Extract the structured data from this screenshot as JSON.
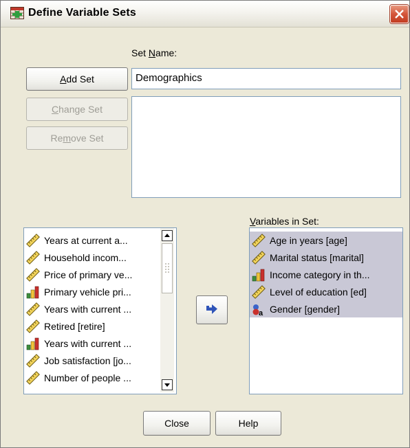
{
  "window": {
    "title": "Define Variable Sets"
  },
  "set_name": {
    "label_pre": "Set ",
    "label_mnemonic": "N",
    "label_post": "ame:",
    "value": "Demographics"
  },
  "buttons": {
    "add_set": {
      "pre": "",
      "mnemonic": "A",
      "post": "dd Set"
    },
    "change_set": {
      "pre": "",
      "mnemonic": "C",
      "post": "hange Set"
    },
    "remove_set": {
      "pre": "Re",
      "mnemonic": "m",
      "post": "ove Set"
    },
    "close": "Close",
    "help": "Help"
  },
  "source_list": {
    "items": [
      {
        "label": "Years at current a...",
        "icon": "scale-icon"
      },
      {
        "label": "Household incom...",
        "icon": "scale-icon"
      },
      {
        "label": "Price of primary ve...",
        "icon": "scale-icon"
      },
      {
        "label": "Primary vehicle pri...",
        "icon": "ordinal-icon"
      },
      {
        "label": "Years with current ...",
        "icon": "scale-icon"
      },
      {
        "label": "Retired [retire]",
        "icon": "scale-icon"
      },
      {
        "label": "Years with current ...",
        "icon": "ordinal-icon"
      },
      {
        "label": "Job satisfaction [jo...",
        "icon": "scale-icon"
      },
      {
        "label": "Number of people ...",
        "icon": "scale-icon"
      }
    ]
  },
  "set_variables": {
    "label_pre": "",
    "label_mnemonic": "V",
    "label_post": "ariables in Set:",
    "items": [
      {
        "label": "Age in years [age]",
        "icon": "scale-icon"
      },
      {
        "label": "Marital status [marital]",
        "icon": "scale-icon"
      },
      {
        "label": "Income category in th...",
        "icon": "ordinal-icon"
      },
      {
        "label": "Level of education [ed]",
        "icon": "scale-icon"
      },
      {
        "label": "Gender [gender]",
        "icon": "nominal-icon"
      }
    ]
  },
  "colors": {
    "dialog_bg": "#ece9d8",
    "selection_bg": "#c9c8d6",
    "field_border": "#7f9db9",
    "close_red": "#d4553a"
  }
}
